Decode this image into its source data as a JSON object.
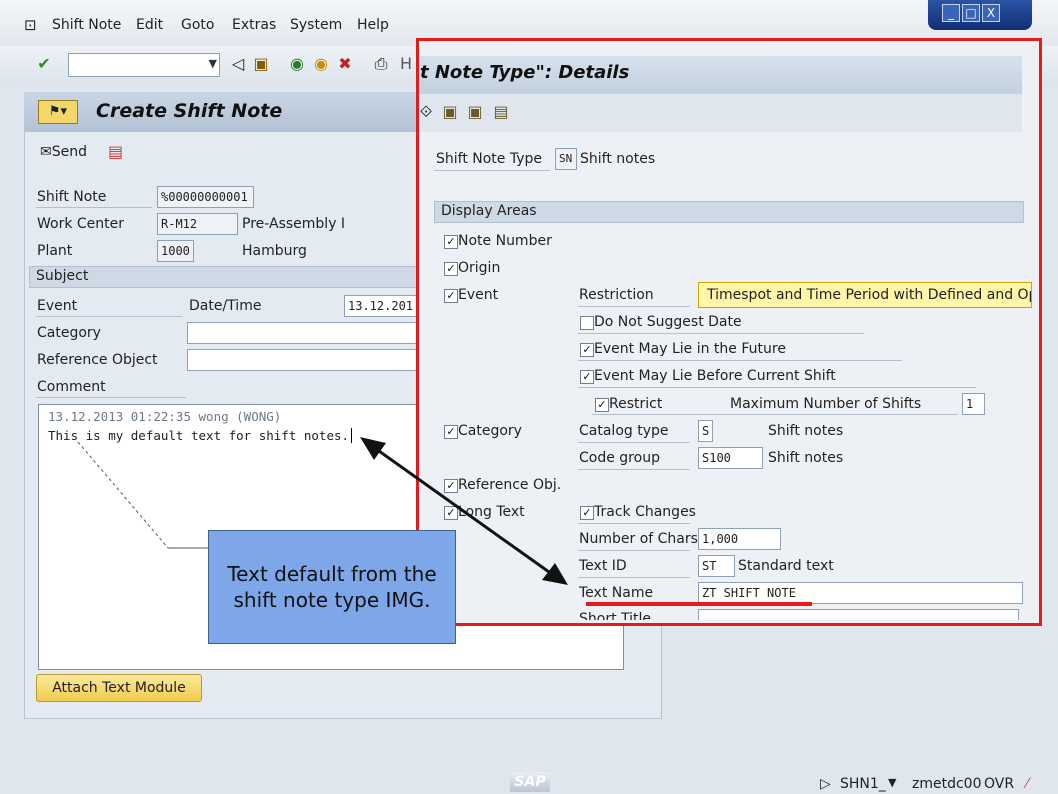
{
  "menu": {
    "items": [
      "Shift Note",
      "Edit",
      "Goto",
      "Extras",
      "System",
      "Help"
    ]
  },
  "window_controls": [
    "_",
    "□",
    "X"
  ],
  "toolbar": {
    "icons": [
      "check-icon",
      "back-icon",
      "save-icon",
      "exit-icon",
      "cancel-icon",
      "print-icon",
      "find-icon"
    ]
  },
  "left": {
    "title": "Create Shift Note",
    "send_label": "Send",
    "shift_note_label": "Shift Note",
    "shift_note_value": "%00000000001",
    "work_center_label": "Work Center",
    "work_center_value": "R-M12",
    "work_center_desc": "Pre-Assembly I",
    "plant_label": "Plant",
    "plant_value": "1000",
    "plant_desc": "Hamburg",
    "subject_label": "Subject",
    "event_label": "Event",
    "datetime_label": "Date/Time",
    "date_value": "13.12.201",
    "category_label": "Category",
    "reference_label": "Reference Object",
    "comment_label": "Comment",
    "comment_line1": "13.12.2013 01:22:35  wong (WONG)",
    "comment_line2": "This is my default text for shift notes.",
    "attach_button": "Attach Text Module"
  },
  "right": {
    "title": "t Note Type\": Details",
    "shift_note_type_label": "Shift Note Type",
    "shift_note_type_value": "SN",
    "shift_note_type_desc": "Shift notes",
    "display_areas_label": "Display Areas",
    "note_number": "Note Number",
    "origin": "Origin",
    "event": "Event",
    "restriction_label": "Restriction",
    "restriction_value": "Timespot and Time Period with Defined and Open En",
    "do_not_suggest": "Do Not Suggest Date",
    "future": "Event May Lie in the Future",
    "before_shift": "Event May Lie Before Current Shift",
    "restrict": "Restrict",
    "max_shifts_label": "Maximum Number of Shifts",
    "max_shifts_value": "1",
    "category": "Category",
    "catalog_type_label": "Catalog type",
    "catalog_type_value": "S",
    "catalog_type_desc": "Shift notes",
    "code_group_label": "Code group",
    "code_group_value": "S100",
    "code_group_desc": "Shift notes",
    "reference_obj": "Reference Obj.",
    "long_text": "Long Text",
    "track_changes": "Track Changes",
    "num_chars_label": "Number of Chars",
    "num_chars_value": "1,000",
    "text_id_label": "Text ID",
    "text_id_value": "ST",
    "text_id_desc": "Standard text",
    "text_name_label": "Text Name",
    "text_name_value": "ZT SHIFT NOTE",
    "short_title_label": "Short Title"
  },
  "callout": "Text default from the shift note type IMG.",
  "status": {
    "logo": "SAP",
    "transaction": "SHN1_",
    "server": "zmetdc00",
    "mode": "OVR"
  },
  "colors": {
    "highlight_frame": "#e41b1b",
    "callout_bg": "#7da7e9",
    "tooltip_bg": "#fff5a8"
  }
}
